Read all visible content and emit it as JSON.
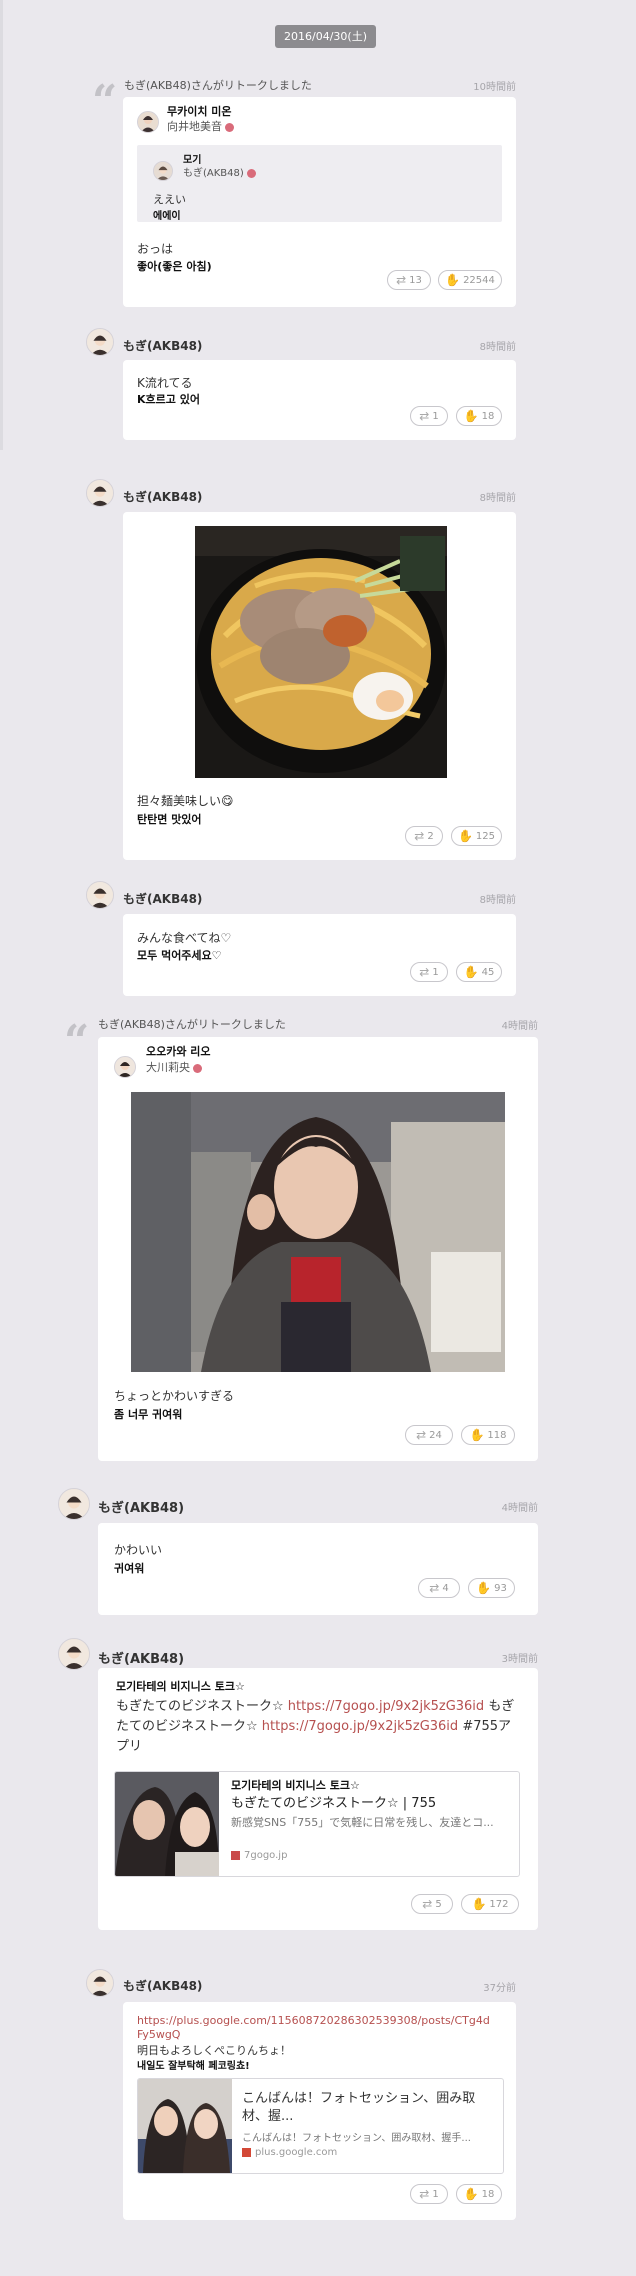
{
  "date_badge": "2016/04/30(土)",
  "posts": [
    {
      "retalk_header": "もぎ(AKB48)さんがリトークしました",
      "time": "10時間前",
      "author_name_ko": "무카이치 미온",
      "author_name": "向井地美音",
      "quoted": {
        "name_ko": "모기",
        "name": "もぎ(AKB48)",
        "text": "ええい",
        "text_ko": "에에이"
      },
      "text": "おっは",
      "text_ko": "좋아(좋은 아침)",
      "retalk_count": "13",
      "like_count": "22544"
    },
    {
      "author": "もぎ(AKB48)",
      "time": "8時間前",
      "text": "K流れてる",
      "text_ko": "K흐르고 있어",
      "retalk_count": "1",
      "like_count": "18"
    },
    {
      "author": "もぎ(AKB48)",
      "time": "8時間前",
      "image": "tantanmen-photo",
      "text": "担々麺美味しい😋",
      "text_ko": "탄탄면 맛있어",
      "retalk_count": "2",
      "like_count": "125"
    },
    {
      "author": "もぎ(AKB48)",
      "time": "8時間前",
      "text": "みんな食べてね♡",
      "text_ko": "모두 먹어주세요♡",
      "retalk_count": "1",
      "like_count": "45"
    },
    {
      "retalk_header": "もぎ(AKB48)さんがリトークしました",
      "time": "4時間前",
      "author_name_ko": "오오카와 리오",
      "author_name": "大川莉央",
      "image": "girl-photo",
      "text": "ちょっとかわいすぎる",
      "text_ko": "좀 너무 귀여워",
      "retalk_count": "24",
      "like_count": "118"
    },
    {
      "author": "もぎ(AKB48)",
      "time": "4時間前",
      "text": "かわいい",
      "text_ko": "귀여워",
      "retalk_count": "4",
      "like_count": "93"
    },
    {
      "author": "もぎ(AKB48)",
      "time": "3時間前",
      "title_ko": "모기타테의 비지니스 토크☆",
      "text_a": "もぎたてのビジネストーク☆ ",
      "link_a": "https://7gogo.jp/9x2jk5zG36id",
      "text_b": " もぎ",
      "text_c": "たてのビジネストーク☆ ",
      "link_b": "https://7gogo.jp/9x2jk5zG36id",
      "text_d": " #755ア",
      "text_e": "プリ",
      "card": {
        "title_ko": "모기타테의 비지니스 토크☆",
        "title": "もぎたてのビジネストーク☆ | 755",
        "desc": "新感覚SNS「755」で気軽に日常を残し、友達とコ...",
        "domain": "7gogo.jp"
      },
      "retalk_count": "5",
      "like_count": "172"
    },
    {
      "author": "もぎ(AKB48)",
      "time": "37分前",
      "link_1": "https://plus.google.com/115608720286302539308/posts/CTg4d",
      "link_2": "Fy5wgQ",
      "text": "明日もよろしくぺこりんちょ！",
      "text_ko": "내일도 잘부탁해 페코링쵸!",
      "card": {
        "title_1": "こんばんは！フォトセッション、囲み取",
        "title_2": "材、握...",
        "desc": "こんばんは！フォトセッション、囲み取材、握手...",
        "domain": "plus.google.com"
      },
      "retalk_count": "1",
      "like_count": "18"
    }
  ],
  "icons": {
    "retalk": "retalk-icon",
    "like": "clap-icon",
    "quote": "quote-mark-icon",
    "verified": "verified-badge-icon"
  },
  "colors": {
    "background": "#eae8ed",
    "card": "#ffffff",
    "link": "#b6504f",
    "badge": "#8c8b8f"
  }
}
